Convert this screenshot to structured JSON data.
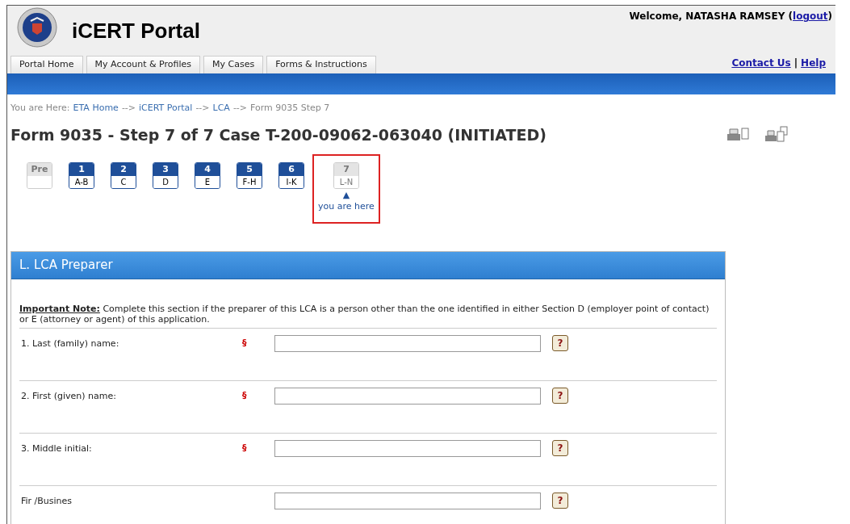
{
  "header": {
    "title": "iCERT Portal",
    "welcome": "Welcome, NATASHA RAMSEY (",
    "logout": "logout",
    "welcome_end": ")"
  },
  "nav_tabs": [
    {
      "label": "Portal Home"
    },
    {
      "label": "My Account & Profiles"
    },
    {
      "label": "My Cases"
    },
    {
      "label": "Forms & Instructions"
    }
  ],
  "top_links": [
    {
      "label": "Contact Us"
    },
    {
      "label": "Help"
    }
  ],
  "top_link_separator": "|",
  "breadcrumb": [
    {
      "label": "You are Here:",
      "kind": "text"
    },
    {
      "label": "ETA Home",
      "kind": "link"
    },
    {
      "label": "-->",
      "kind": "sep"
    },
    {
      "label": "iCERT Portal",
      "kind": "link"
    },
    {
      "label": "-->",
      "kind": "sep"
    },
    {
      "label": "LCA",
      "kind": "link"
    },
    {
      "label": "-->",
      "kind": "sep"
    },
    {
      "label": "Form 9035 Step 7",
      "kind": "text"
    }
  ],
  "page_title": "Form 9035 - Step 7 of 7 Case T-200-09062-063040 (INITIATED)",
  "steps": [
    {
      "number": "Pre",
      "available": false,
      "selected": false
    },
    {
      "number": "1",
      "sections": "A-B",
      "available": true,
      "selected": false
    },
    {
      "number": "2",
      "sections": "C",
      "available": true,
      "selected": false
    },
    {
      "number": "3",
      "sections": "D",
      "available": true,
      "selected": false
    },
    {
      "number": "4",
      "sections": "E",
      "available": true,
      "selected": false
    },
    {
      "number": "5",
      "sections": "F-H",
      "available": true,
      "selected": false
    },
    {
      "number": "6",
      "sections": "I-K",
      "available": true,
      "selected": false
    },
    {
      "number": "7",
      "sections": "L-N",
      "available": false,
      "selected": true
    }
  ],
  "current_step_marker": "▲",
  "current_step_label": "you are here",
  "section": {
    "title": "L. LCA Preparer",
    "note": "**Important Note:** Complete this section if the preparer of this LCA is a person other than the one identified in either Section D (employer point of contact) or E (attorney or agent) of this application.",
    "fields": [
      {
        "label": "1. Last (family) name:",
        "required_mark": "§",
        "help": "?"
      },
      {
        "label": "2. First (given) name:",
        "required_mark": "§",
        "help": "?"
      },
      {
        "label": "3. Middle initial:",
        "required_mark": "§",
        "help": "?"
      },
      {
        "label": "Fir /Busines",
        "help": "?"
      }
    ]
  }
}
